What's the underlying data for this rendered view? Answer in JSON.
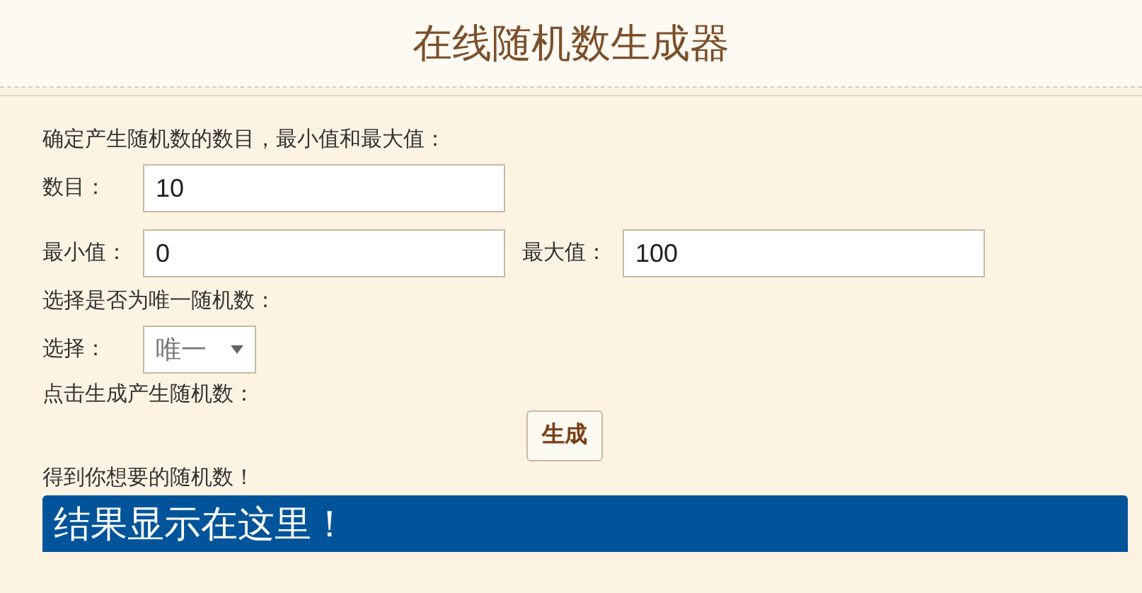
{
  "title": "在线随机数生成器",
  "intro": "确定产生随机数的数目，最小值和最大值：",
  "count": {
    "label": "数目：",
    "value": "10"
  },
  "min": {
    "label": "最小值：",
    "value": "0"
  },
  "max": {
    "label": "最大值：",
    "value": "100"
  },
  "unique_prompt": "选择是否为唯一随机数：",
  "select": {
    "label": "选择：",
    "value": "唯一"
  },
  "generate_prompt": "点击生成产生随机数：",
  "generate_button": "生成",
  "result_prompt": "得到你想要的随机数！",
  "result": "结果显示在这里！"
}
